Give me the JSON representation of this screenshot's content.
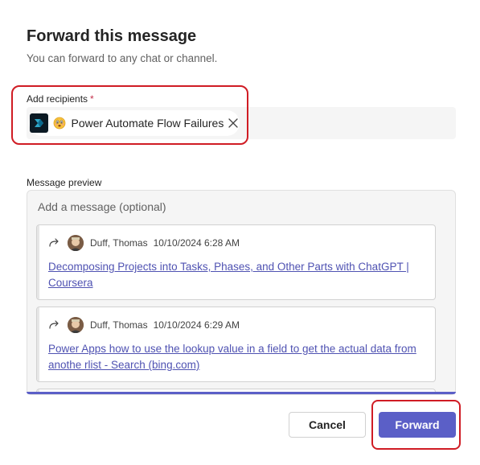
{
  "dialog": {
    "title": "Forward this message",
    "subtitle": "You can forward to any chat or channel."
  },
  "recipients": {
    "label": "Add recipients",
    "required_marker": "*",
    "chips": [
      {
        "label": "Power Automate Flow Failures",
        "icon": "power-automate-icon",
        "emoji": "face-emoji"
      }
    ]
  },
  "preview": {
    "label": "Message preview",
    "message_placeholder": "Add a message (optional)",
    "messages": [
      {
        "sender": "Duff, Thomas",
        "timestamp": "10/10/2024 6:28 AM",
        "link_text": "Decomposing Projects into Tasks, Phases, and Other Parts with ChatGPT | Coursera"
      },
      {
        "sender": "Duff, Thomas",
        "timestamp": "10/10/2024 6:29 AM",
        "link_text": "Power Apps how to use the lookup value in a field to get the actual data from anothe rlist - Search (bing.com)"
      }
    ]
  },
  "actions": {
    "cancel_label": "Cancel",
    "forward_label": "Forward"
  },
  "colors": {
    "accent": "#5b5fc7",
    "link": "#4f52b2",
    "highlight": "#d01c24",
    "required": "#c4314b"
  }
}
